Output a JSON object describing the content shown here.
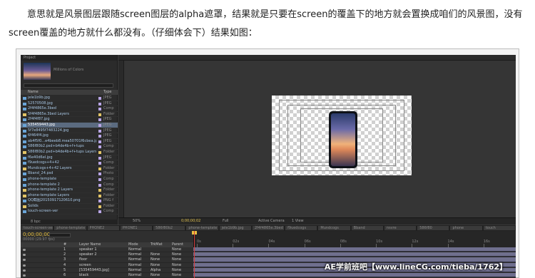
{
  "article": {
    "paragraph": "意思就是风景图层跟随screen图层的alpha遮罩，结果就是只要在screen的覆盖下的地方就会置换成咱们的风景图，没有screen覆盖的地方就什么都没有。（仔细体会下）结果如图："
  },
  "project_panel": {
    "tab_label": "Project",
    "thumbnail_caption": "Millions of Colors",
    "column_name": "Name",
    "column_type": "Type",
    "items": [
      {
        "name": "jele1b9b.jpg",
        "type": "JPEG",
        "icon_color": "#6aa5d8",
        "label_color": "#b9a6e6"
      },
      {
        "name": "52570508.jpg",
        "type": "JPEG",
        "icon_color": "#6aa5d8",
        "label_color": "#b9a6e6"
      },
      {
        "name": "2f4f4865e.3bed",
        "type": "Comp",
        "icon_color": "#6aa5d8",
        "label_color": "#b9a6e6"
      },
      {
        "name": "5f4f4865e.3bed Layers",
        "type": "Folder",
        "icon_color": "#e2c466",
        "label_color": "#e2c466"
      },
      {
        "name": "2f4f4f87.jpg",
        "type": "JPEG",
        "icon_color": "#6aa5d8",
        "label_color": "#b9a6e6"
      },
      {
        "name": "535459443.jpg",
        "type": "JPEG",
        "icon_color": "#6aa5d8",
        "label_color": "#b9a6e6",
        "selected": true
      },
      {
        "name": "5f7e8495f7483224.jpg",
        "type": "JPEG",
        "icon_color": "#6aa5d8",
        "label_color": "#b9a6e6"
      },
      {
        "name": "6f464f4.jpg",
        "type": "JPEG",
        "icon_color": "#6aa5d8",
        "label_color": "#b9a6e6"
      },
      {
        "name": "ab4f5f0...e4beeb8.mea50701f6cbea.jpg",
        "type": "JPEG",
        "icon_color": "#6aa5d8",
        "label_color": "#b9a6e6"
      },
      {
        "name": "586f80b2.psd+b4de4b+f+tups",
        "type": "Comp",
        "icon_color": "#6aa5d8",
        "label_color": "#b9a6e6"
      },
      {
        "name": "586f80b2.psd+b4de4b+f+tups Layers",
        "type": "Folder",
        "icon_color": "#e2c466",
        "label_color": "#e2c466"
      },
      {
        "name": "f6e40d6el.jpg",
        "type": "JPEG",
        "icon_color": "#6aa5d8",
        "label_color": "#b9a6e6"
      },
      {
        "name": "f9uedcogs+4+42",
        "type": "Comp",
        "icon_color": "#6aa5d8",
        "label_color": "#b9a6e6"
      },
      {
        "name": "Mundcogs+4+42 Layers",
        "type": "Folder",
        "icon_color": "#e2c466",
        "label_color": "#e2c466"
      },
      {
        "name": "Bband_24.psd",
        "type": "Photo",
        "icon_color": "#6aa5d8",
        "label_color": "#b9a6e6"
      },
      {
        "name": "phone-template",
        "type": "Comp",
        "icon_color": "#6aa5d8",
        "label_color": "#b9a6e6"
      },
      {
        "name": "phone-template 2",
        "type": "Comp",
        "icon_color": "#6aa5d8",
        "label_color": "#b9a6e6"
      },
      {
        "name": "phone-template 2 Layers",
        "type": "Folder",
        "icon_color": "#e2c466",
        "label_color": "#e2c466"
      },
      {
        "name": "phone-template Layers",
        "type": "Folder",
        "icon_color": "#e2c466",
        "label_color": "#e2c466"
      },
      {
        "name": "QQ截图20150917120610.png",
        "type": "PNG f",
        "icon_color": "#6aa5d8",
        "label_color": "#b9a6e6"
      },
      {
        "name": "Solids",
        "type": "Folder",
        "icon_color": "#e2c466",
        "label_color": "#e2c466"
      },
      {
        "name": "touch-screen-ver",
        "type": "Comp",
        "icon_color": "#6aa5d8",
        "label_color": "#b9a6e6"
      }
    ],
    "footer_label": "8 bpc"
  },
  "viewer": {
    "zoom": "50%",
    "timecode": "0;00;00;02",
    "resolution": "Full",
    "camera": "Active Camera",
    "views": "1 View"
  },
  "comp_tabs": [
    "touch-screen-ver",
    "phone-template 2",
    "PHONE2",
    "PHONE1",
    "586f80b2",
    "phone-template",
    "jele1b9b.jpg",
    "2f4f4865e.3bed",
    "f9uedcogs",
    "Mundcogs",
    "Bband",
    "nsvre",
    "586f80",
    "phone",
    "touch"
  ],
  "timeline": {
    "current_time": "0;00;00;00",
    "frames": "00000 (29.97 fps)",
    "columns": {
      "number": "#",
      "source": "Layer Name",
      "mode": "Mode",
      "trkmat": "TrkMat",
      "parent": "Parent"
    },
    "layers": [
      {
        "number": "1",
        "name": "speaker 1",
        "mode": "Normal",
        "trkmat": "",
        "parent": "None"
      },
      {
        "number": "2",
        "name": "speaker 2",
        "mode": "Normal",
        "trkmat": "None",
        "parent": "None"
      },
      {
        "number": "3",
        "name": "floor",
        "mode": "Normal",
        "trkmat": "None",
        "parent": "None"
      },
      {
        "number": "4",
        "name": "screen",
        "mode": "Normal",
        "trkmat": "None",
        "parent": "None"
      },
      {
        "number": "5",
        "name": "[535459443.jpg]",
        "mode": "Normal",
        "trkmat": "Alpha",
        "parent": "None"
      },
      {
        "number": "6",
        "name": "black",
        "mode": "Normal",
        "trkmat": "None",
        "parent": "None"
      }
    ],
    "ruler_ticks": [
      "0s",
      "02s",
      "04s",
      "06s",
      "08s",
      "10s",
      "12s",
      "14s",
      "16s"
    ]
  },
  "watermark": "AE学前班吧【www.lineCG.com/tieba/1762】",
  "colors": {
    "ae_background": "#3a3a3a",
    "layer_bar": "#6f6f8e",
    "playhead": "#d23b3b",
    "timecode": "#e8c040"
  }
}
